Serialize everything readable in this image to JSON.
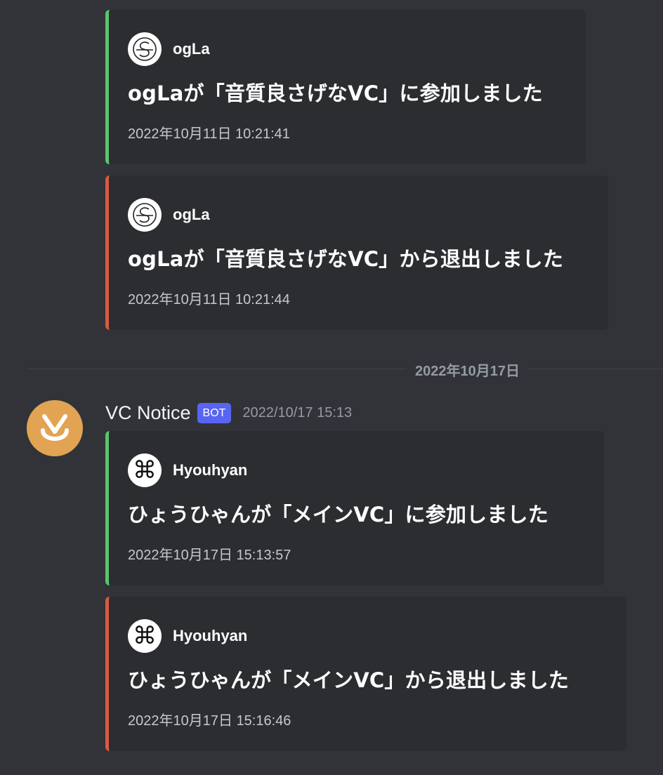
{
  "embeds_before": [
    {
      "author": "ogLa",
      "title": "ogLaが「音質良さげなVC」に参加しました",
      "footer": "2022年10月11日 10:21:41",
      "kind": "join",
      "color": "#5cc46e"
    },
    {
      "author": "ogLa",
      "title": "ogLaが「音質良さげなVC」から退出しました",
      "footer": "2022年10月11日 10:21:44",
      "kind": "leave",
      "color": "#da5a43"
    }
  ],
  "date_divider": "2022年10月17日",
  "message": {
    "username": "VC Notice",
    "badge": "BOT",
    "timestamp": "2022/10/17 15:13",
    "avatar_color": "#e2a452"
  },
  "embeds_after": [
    {
      "author": "Hyouhyan",
      "title": "ひょうひゃんが「メインVC」に参加しました",
      "footer": "2022年10月17日 15:13:57",
      "kind": "join",
      "color": "#5cc46e"
    },
    {
      "author": "Hyouhyan",
      "title": "ひょうひゃんが「メインVC」から退出しました",
      "footer": "2022年10月17日 15:16:46",
      "kind": "leave",
      "color": "#da5a43"
    }
  ],
  "icons": {
    "ogla_avatar": "ogla-logo-icon",
    "hyouhyan_avatar": "command-symbol-icon",
    "bot_avatar": "vc-notice-logo-icon"
  }
}
